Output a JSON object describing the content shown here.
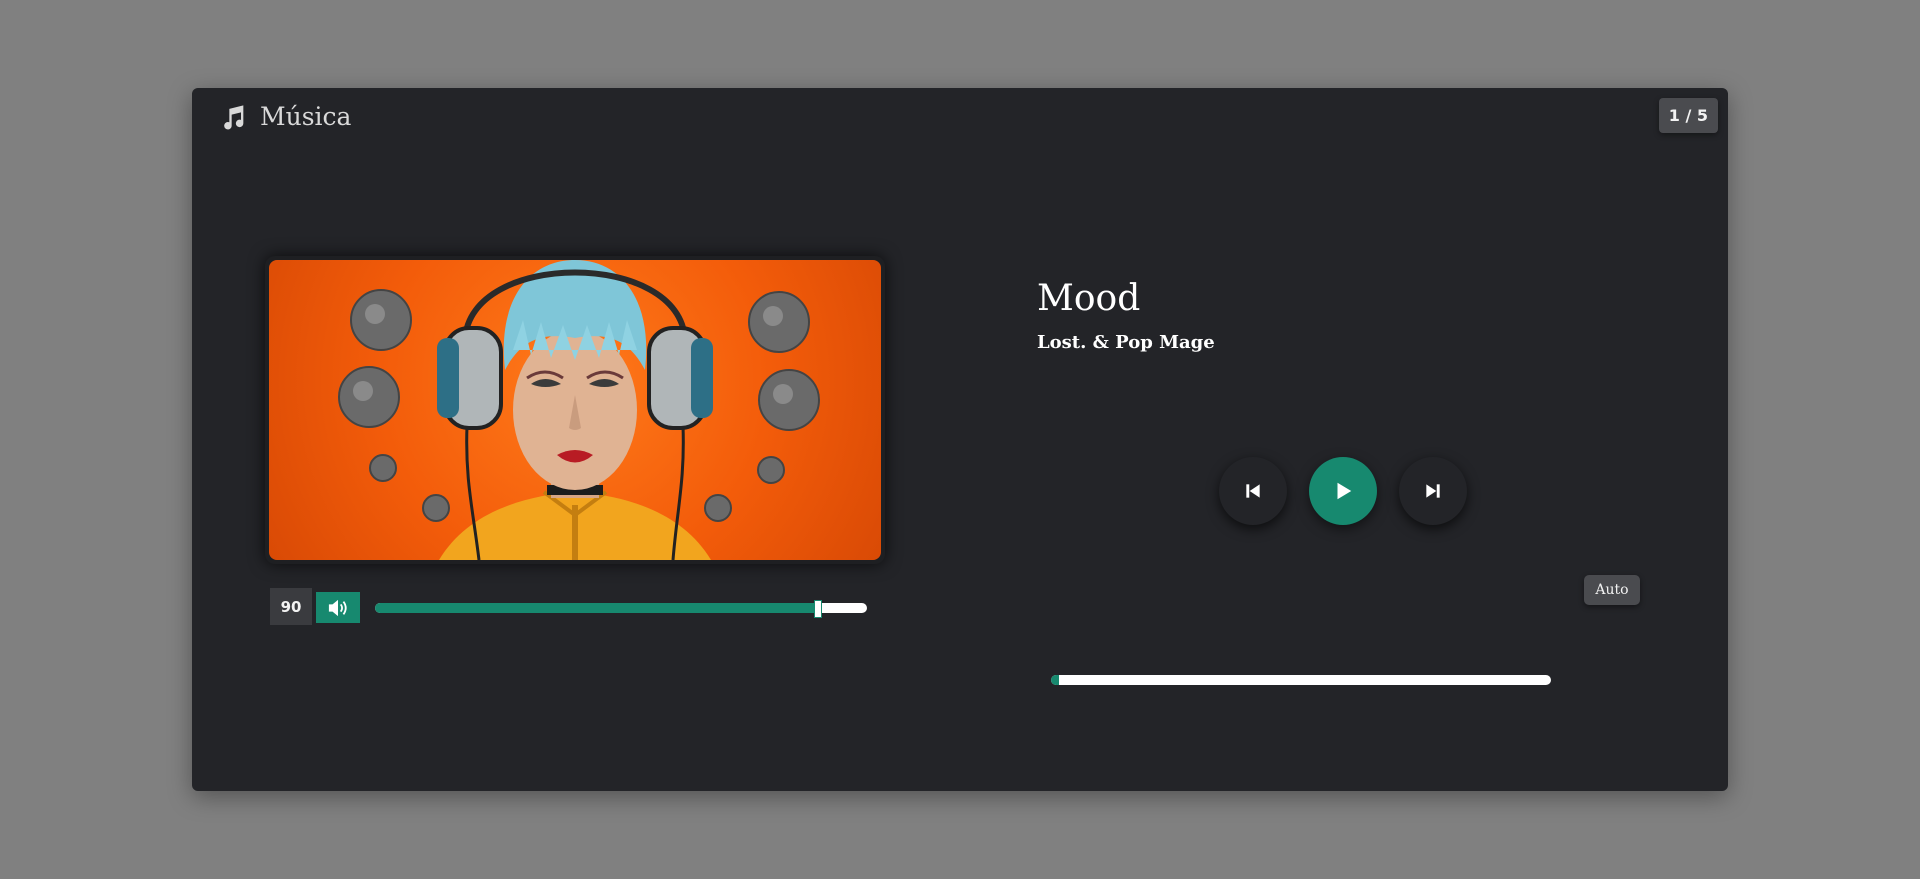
{
  "app": {
    "title": "Música",
    "icon": "music-note-icon",
    "page_indicator": "1 / 5"
  },
  "track": {
    "title": "Mood",
    "artist": "Lost. & Pop Mage",
    "cover_image": "woman-with-headphones"
  },
  "volume": {
    "value": "90",
    "level": 0.9,
    "icon": "volume-icon"
  },
  "controls": {
    "previous_icon": "skip-previous-icon",
    "play_icon": "play-icon",
    "next_icon": "skip-next-icon"
  },
  "progress": {
    "level": 0.0,
    "auto_label": "Auto"
  },
  "colors": {
    "accent": "#17896f",
    "panel": "#232428",
    "page_background": "#808080"
  }
}
